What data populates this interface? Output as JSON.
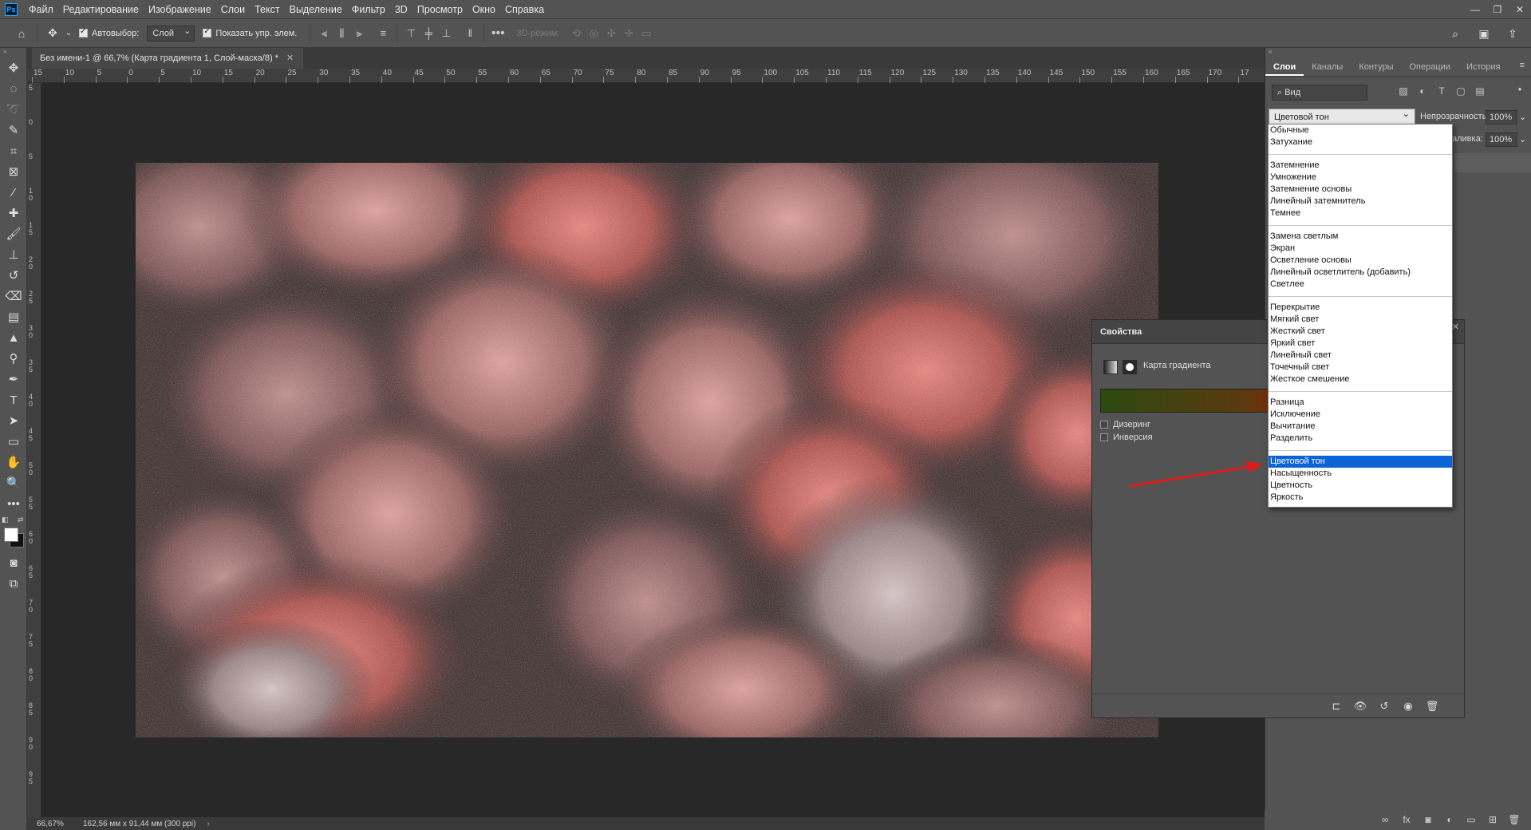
{
  "app": {
    "menu": [
      "Файл",
      "Редактирование",
      "Изображение",
      "Слои",
      "Текст",
      "Выделение",
      "Фильтр",
      "3D",
      "Просмотр",
      "Окно",
      "Справка"
    ],
    "logo": "Ps"
  },
  "options": {
    "autoselect_label": "Автовыбор:",
    "autoselect_value": "Слой",
    "show_transform_label": "Показать упр. элем.",
    "mode3d_label": "3D-режим:"
  },
  "document": {
    "tab_title": "Без имени-1 @ 66,7% (Карта градиента 1, Слой-маска/8) *",
    "zoom": "66,67%",
    "doc_info": "162,56 мм x 91,44 мм (300 ppi)"
  },
  "ruler": {
    "h_labels": [
      "15",
      "10",
      "5",
      "0",
      "5",
      "10",
      "15",
      "20",
      "25",
      "30",
      "35",
      "40",
      "45",
      "50",
      "55",
      "60",
      "65",
      "70",
      "75",
      "80",
      "85",
      "90",
      "95",
      "100",
      "105",
      "110",
      "115",
      "120",
      "125",
      "130",
      "135",
      "140",
      "145",
      "150",
      "155",
      "160",
      "165",
      "170",
      "17"
    ],
    "v_labels": [
      "5",
      "0",
      "5",
      "1\n0",
      "1\n5",
      "2\n0",
      "2\n5",
      "3\n0",
      "3\n5",
      "4\n0",
      "4\n5",
      "5\n0",
      "5\n5",
      "6\n0",
      "6\n5",
      "7\n0",
      "7\n5",
      "8\n0",
      "8\n5",
      "9\n0",
      "9\n5"
    ]
  },
  "layers_panel": {
    "tabs": [
      "Слои",
      "Каналы",
      "Контуры",
      "Операции",
      "История"
    ],
    "filter": "Вид",
    "blend_mode": "Цветовой тон",
    "opacity_label": "Непрозрачность:",
    "opacity_value": "100%",
    "fill_label": "аливка:",
    "fill_value": "100%"
  },
  "blend_modes": {
    "groups": [
      [
        "Обычные",
        "Затухание"
      ],
      [
        "Затемнение",
        "Умножение",
        "Затемнение основы",
        "Линейный затемнитель",
        "Темнее"
      ],
      [
        "Замена светлым",
        "Экран",
        "Осветление основы",
        "Линейный осветлитель (добавить)",
        "Светлее"
      ],
      [
        "Перекрытие",
        "Мягкий свет",
        "Жесткий свет",
        "Яркий свет",
        "Линейный свет",
        "Точечный свет",
        "Жесткое смешение"
      ],
      [
        "Разница",
        "Исключение",
        "Вычитание",
        "Разделить"
      ],
      [
        "Цветовой тон",
        "Насыщенность",
        "Цветность",
        "Яркость"
      ]
    ],
    "selected": "Цветовой тон"
  },
  "properties": {
    "title": "Свойства",
    "layer_type": "Карта градиента",
    "dither_label": "Дизеринг",
    "reverse_label": "Инверсия",
    "gradient_start": "#2c4a11",
    "gradient_end": "#d80a0a"
  },
  "colors": {
    "accent_selection": "#0a64d8",
    "arrow": "#e0191b"
  }
}
